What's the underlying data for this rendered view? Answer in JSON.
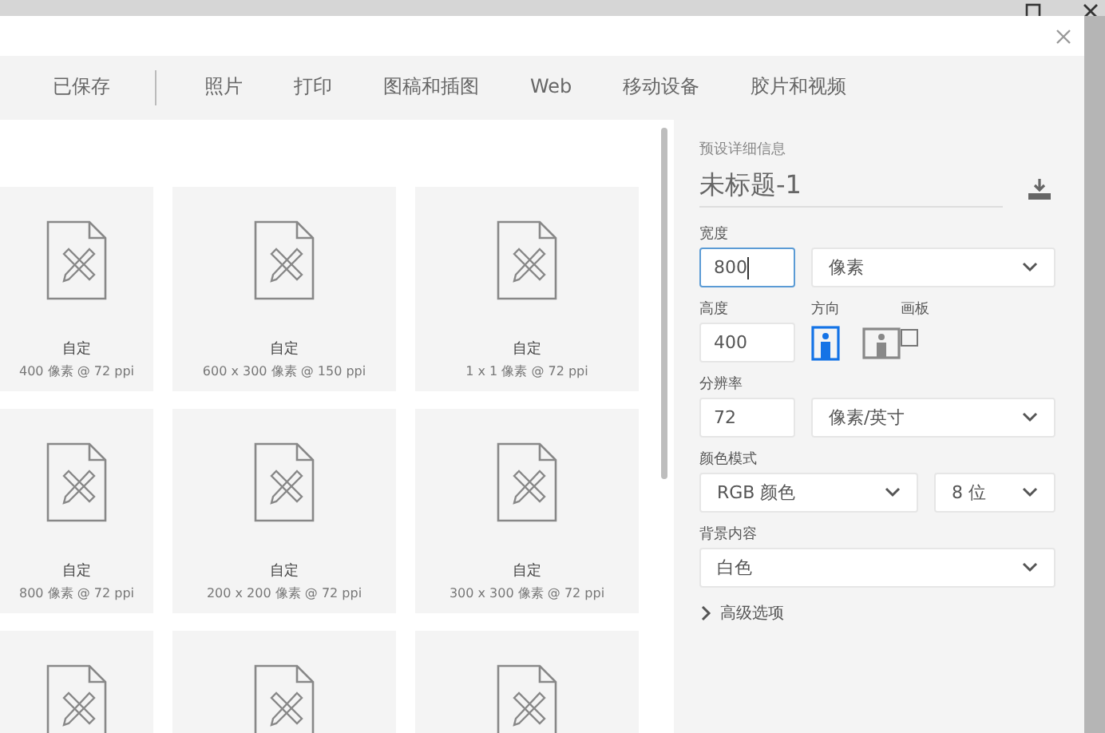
{
  "tabs": [
    {
      "label": "已保存",
      "selected": false
    },
    {
      "label": "照片",
      "selected": false
    },
    {
      "label": "打印",
      "selected": false
    },
    {
      "label": "图稿和插图",
      "selected": false
    },
    {
      "label": "Web",
      "selected": false
    },
    {
      "label": "移动设备",
      "selected": false
    },
    {
      "label": "胶片和视频",
      "selected": false
    }
  ],
  "presets": [
    {
      "title": "自定",
      "size": "400 像素 @ 72 ppi",
      "selected": false
    },
    {
      "title": "自定",
      "size": "600 x 300 像素 @ 150 ppi",
      "selected": false
    },
    {
      "title": "自定",
      "size": "1 x 1 像素 @ 72 ppi",
      "selected": false
    },
    {
      "title": "自定",
      "size": "800 像素 @ 72 ppi",
      "selected": false
    },
    {
      "title": "自定",
      "size": "200 x 200 像素 @ 72 ppi",
      "selected": false
    },
    {
      "title": "自定",
      "size": "300 x 300 像素 @ 72 ppi",
      "selected": false
    },
    {
      "selected": false
    },
    {
      "selected": false
    },
    {
      "selected": false
    }
  ],
  "details": {
    "heading": "预设详细信息",
    "document_name": "未标题-1",
    "width": {
      "label": "宽度",
      "value": "800",
      "focused": true,
      "unit": "像素"
    },
    "height": {
      "label": "高度",
      "value": "400"
    },
    "orientation": {
      "label": "方向",
      "options": [
        {
          "kind": "portrait",
          "selected": true
        },
        {
          "kind": "landscape",
          "selected": false
        }
      ]
    },
    "artboard": {
      "label": "画板",
      "checked": false
    },
    "resolution": {
      "label": "分辨率",
      "value": "72",
      "unit": "像素/英寸"
    },
    "color_mode": {
      "label": "颜色模式",
      "mode": "RGB 颜色",
      "depth": "8 位"
    },
    "background": {
      "label": "背景内容",
      "value": "白色"
    },
    "advanced": {
      "label": "高级选项",
      "expanded": false
    }
  }
}
